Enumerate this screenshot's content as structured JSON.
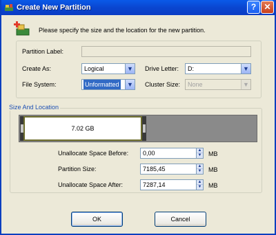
{
  "window": {
    "title": "Create New Partition"
  },
  "intro": "Please specify the size and the location for the new partition.",
  "form": {
    "partition_label": {
      "label": "Partition Label:",
      "value": ""
    },
    "create_as": {
      "label": "Create As:",
      "value": "Logical"
    },
    "drive_letter": {
      "label": "Drive Letter:",
      "value": "D:"
    },
    "file_system": {
      "label": "File System:",
      "value": "Unformatted"
    },
    "cluster_size": {
      "label": "Cluster Size:",
      "value": "None"
    }
  },
  "size_location": {
    "legend": "Size And Location",
    "partition_size_label": "7.02 GB",
    "unallocated_before": {
      "label": "Unallocate Space Before:",
      "value": "0,00",
      "unit": "MB"
    },
    "partition_size": {
      "label": "Partition Size:",
      "value": "7185,45",
      "unit": "MB"
    },
    "unallocated_after": {
      "label": "Unallocate Space After:",
      "value": "7287,14",
      "unit": "MB"
    }
  },
  "buttons": {
    "ok": "OK",
    "cancel": "Cancel"
  },
  "colors": {
    "titlebar": "#0a46d0",
    "legend_text": "#1c4fb3",
    "partition_border": "#6b6b2a",
    "unallocated": "#8a8a8a"
  }
}
